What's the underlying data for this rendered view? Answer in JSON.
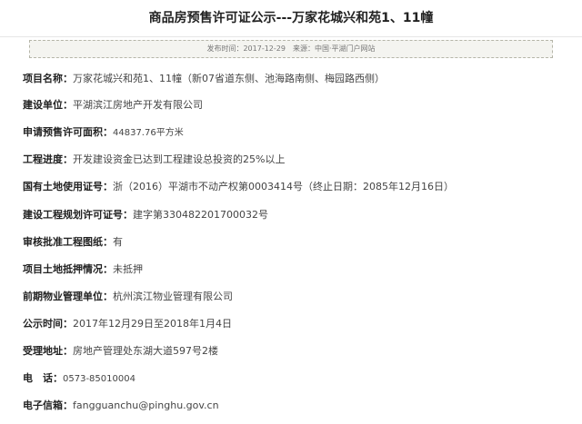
{
  "title": "商品房预售许可证公示---万家花城兴和苑1、11幢",
  "meta": {
    "publish_label": "发布时间：",
    "publish_date": "2017-12-29",
    "source_label": "来源：",
    "source_value": "中国·平湖门户网站"
  },
  "fields": [
    {
      "label": "项目名称：",
      "value": "万家花城兴和苑1、11幢（新07省道东侧、池海路南侧、梅园路西侧）"
    },
    {
      "label": "建设单位：",
      "value": "平湖滨江房地产开发有限公司"
    },
    {
      "label": "申请预售许可面积：",
      "value": "44837.76平方米"
    },
    {
      "label": "工程进度：",
      "value": "开发建设资金已达到工程建设总投资的25%以上"
    },
    {
      "label": "国有土地使用证号：",
      "value": "浙（2016）平湖市不动产权第0003414号（终止日期：2085年12月16日）"
    },
    {
      "label": "建设工程规划许可证号：",
      "value": "建字第330482201700032号"
    },
    {
      "label": "审核批准工程图纸：",
      "value": "有"
    },
    {
      "label": "项目土地抵押情况：",
      "value": "未抵押"
    },
    {
      "label": "前期物业管理单位：",
      "value": "杭州滨江物业管理有限公司"
    },
    {
      "label": "公示时间：",
      "value": "2017年12月29日至2018年1月4日"
    },
    {
      "label": "受理地址：",
      "value": "房地产管理处东湖大道597号2楼"
    },
    {
      "label": "电　话：",
      "value": "0573-85010004"
    },
    {
      "label": "电子信箱：",
      "value": "fangguanchu@pinghu.gov.cn"
    }
  ]
}
